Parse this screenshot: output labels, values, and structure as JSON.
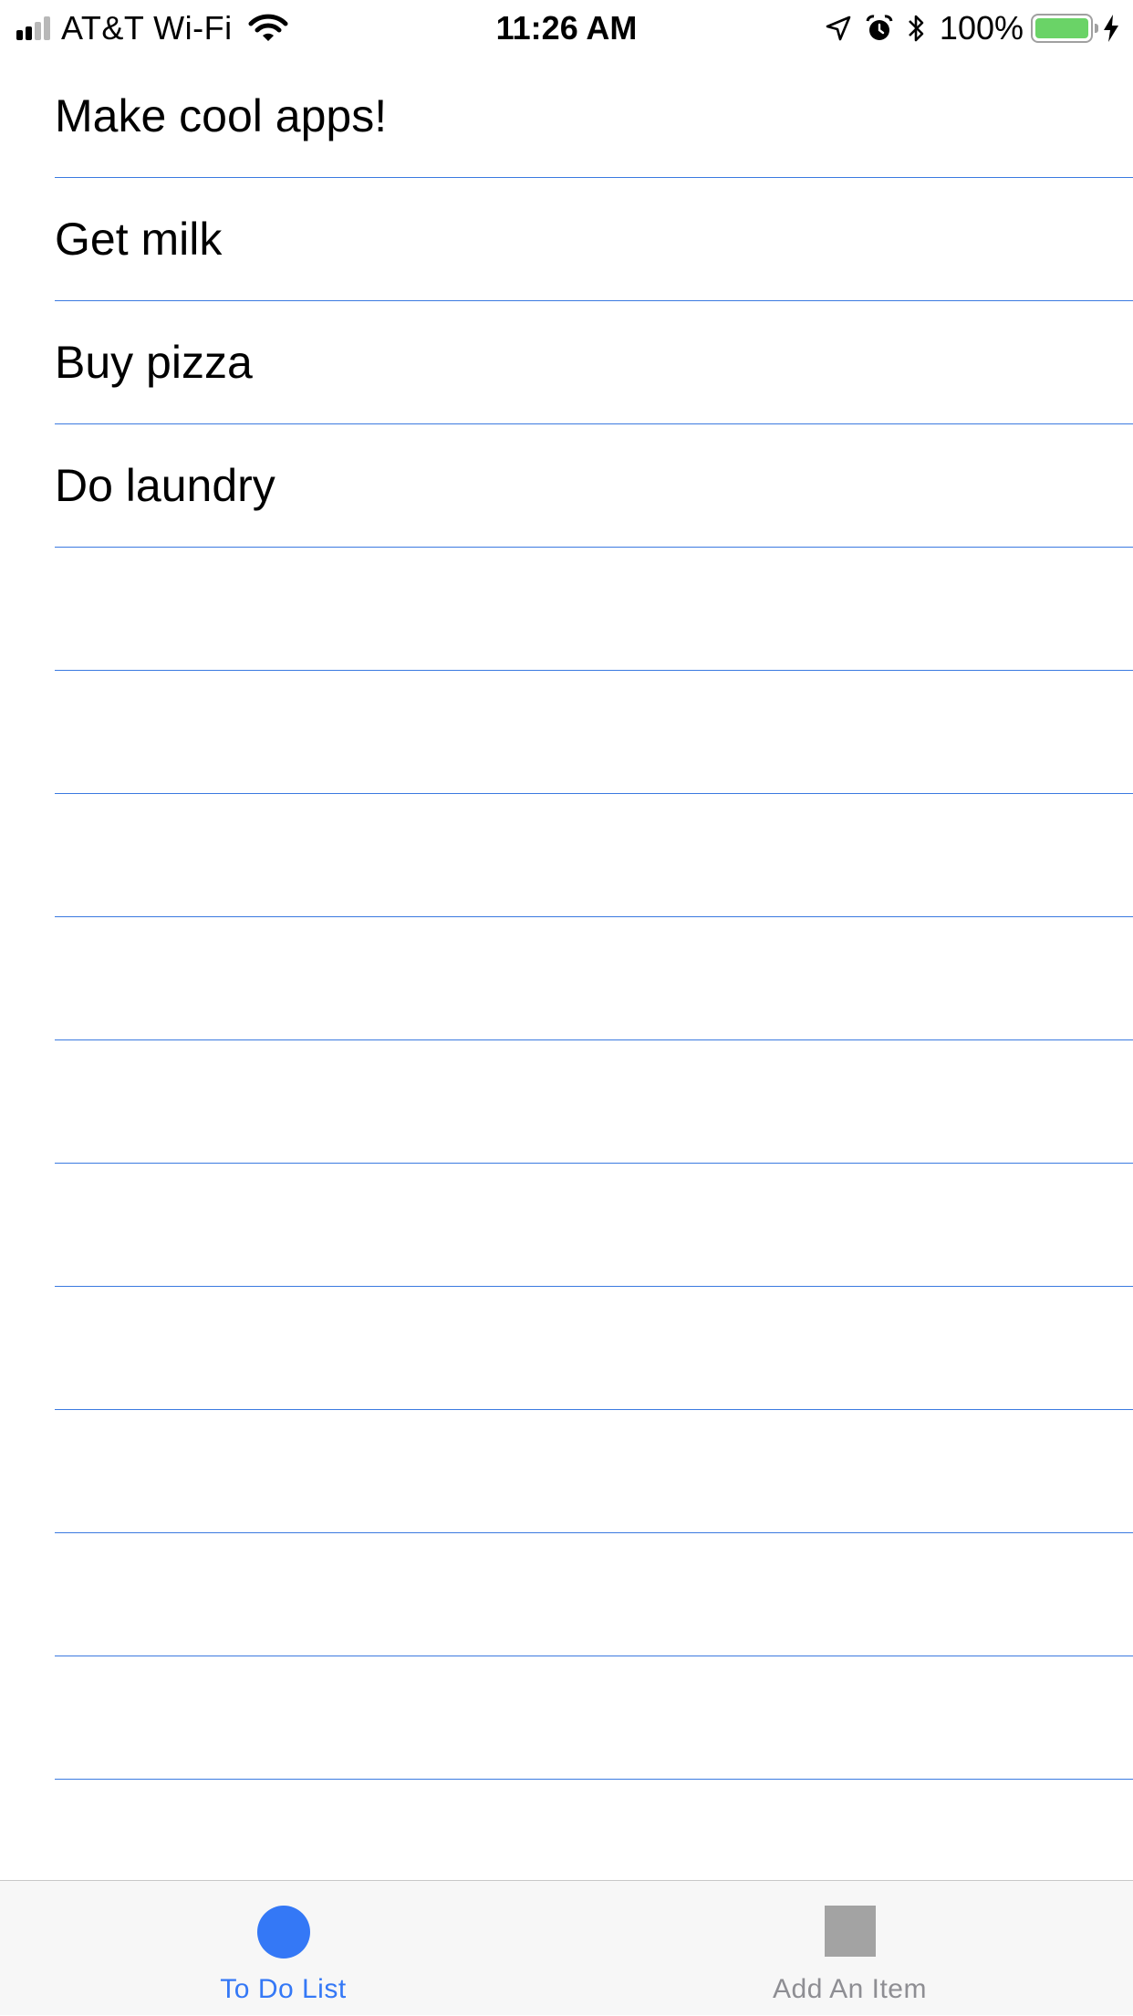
{
  "status_bar": {
    "carrier": "AT&T Wi-Fi",
    "time": "11:26 AM",
    "battery_percent": "100%",
    "signal_bars_active": 2,
    "signal_bars_total": 4,
    "icons": [
      "signal-icon",
      "wifi-icon",
      "location-arrow-icon",
      "alarm-icon",
      "bluetooth-icon",
      "battery-icon",
      "charging-bolt-icon"
    ],
    "battery_color": "#6ad367"
  },
  "todo_list": {
    "items": [
      {
        "label": "Make cool apps!"
      },
      {
        "label": "Get milk"
      },
      {
        "label": "Buy pizza"
      },
      {
        "label": "Do laundry"
      },
      {
        "label": ""
      },
      {
        "label": ""
      },
      {
        "label": ""
      },
      {
        "label": ""
      },
      {
        "label": ""
      },
      {
        "label": ""
      },
      {
        "label": ""
      },
      {
        "label": ""
      },
      {
        "label": ""
      },
      {
        "label": ""
      }
    ],
    "separator_color": "#3b7ae0"
  },
  "tab_bar": {
    "tabs": [
      {
        "label": "To Do List",
        "icon": "circle-icon",
        "selected": true
      },
      {
        "label": "Add An Item",
        "icon": "square-icon",
        "selected": false
      }
    ],
    "selected_color": "#3478f6",
    "unselected_color": "#8e8e93"
  }
}
